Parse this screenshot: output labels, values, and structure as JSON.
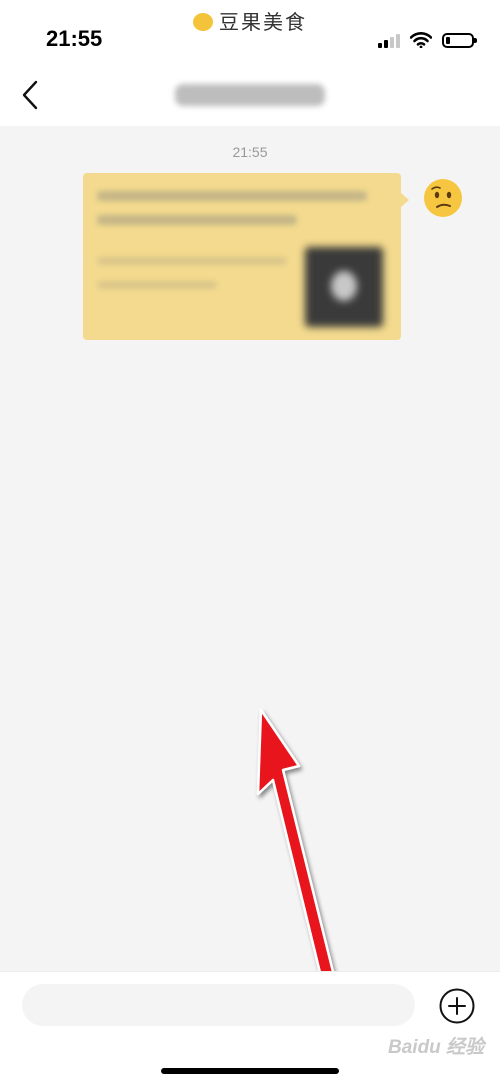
{
  "status_bar": {
    "time": "21:55",
    "watermark": "豆果美食",
    "signal_bars": 2,
    "signal_total": 4,
    "battery_level": 0.18
  },
  "nav": {
    "back_icon": "chevron-left-icon"
  },
  "chat": {
    "timestamp": "21:55",
    "avatar_icon": "confused-face-emoji"
  },
  "input": {
    "placeholder": "",
    "plus_icon": "plus-circle-icon"
  },
  "corner_watermark": "Baidu 经验",
  "colors": {
    "bubble": "#f3da8e",
    "chat_background": "#f4f4f5",
    "arrow": "#e8121c"
  }
}
